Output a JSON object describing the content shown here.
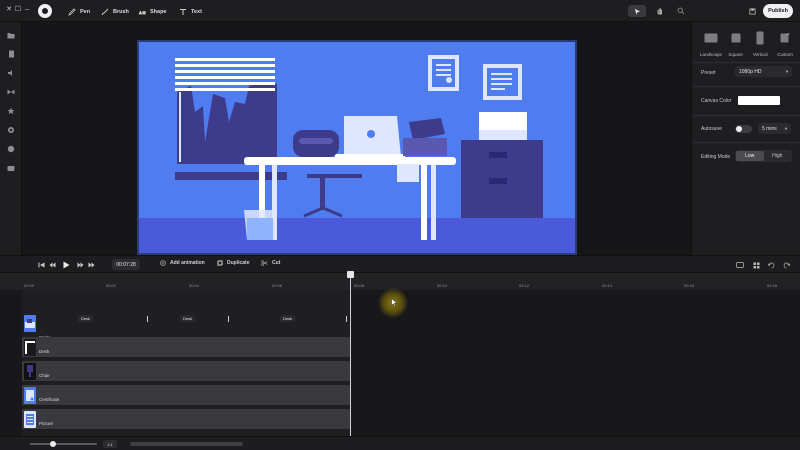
{
  "window": {
    "close": "✕",
    "maximize": "☐",
    "minimize": "–"
  },
  "toolbar": {
    "tools": [
      {
        "label": "Pen",
        "icon": "pen-icon"
      },
      {
        "label": "Brush",
        "icon": "brush-icon"
      },
      {
        "label": "Shape",
        "icon": "shape-icon"
      },
      {
        "label": "Text",
        "icon": "text-icon"
      }
    ],
    "publish_label": "Publish"
  },
  "right_panel": {
    "formats": [
      {
        "label": "Landscape",
        "icon": "landscape-icon"
      },
      {
        "label": "Square",
        "icon": "square-icon"
      },
      {
        "label": "Vertical",
        "icon": "vertical-icon"
      },
      {
        "label": "Custom",
        "icon": "custom-icon"
      }
    ],
    "preset_label": "Preset",
    "preset_value": "1080p HD",
    "canvas_color_label": "Canvas Color",
    "canvas_color_value": "#ffffff",
    "autosave_label": "Autosave",
    "autosave_value": "5 mins",
    "autosave_enabled": false,
    "editing_mode_label": "Editing Mode",
    "editing_mode_options": [
      "Low",
      "High"
    ],
    "editing_mode_selected": "Low"
  },
  "transport": {
    "timecode": "00:07:28",
    "actions": [
      {
        "label": "Add animation",
        "icon": "add-animation-icon"
      },
      {
        "label": "Duplicate",
        "icon": "duplicate-icon"
      },
      {
        "label": "Cut",
        "icon": "scissors-icon"
      }
    ]
  },
  "timeline": {
    "ruler_ticks": [
      "00:00",
      "00:02",
      "00:04",
      "00:06",
      "00:08",
      "00:10",
      "00:12",
      "00:14",
      "00:16",
      "00:18"
    ],
    "keyframe_labels": [
      "Desk",
      "Desk",
      "Desk"
    ],
    "tracks": [
      {
        "name": "Sprite"
      },
      {
        "name": "Desk"
      },
      {
        "name": "Chair"
      },
      {
        "name": "Certificate"
      },
      {
        "name": "Picture"
      }
    ],
    "zoom_ratio": "1:1"
  },
  "colors": {
    "artboard_bg": "#4f7df0",
    "dark_purple": "#3e3a8c",
    "floor": "#4859d6",
    "accent_light": "#dfe6ff"
  }
}
